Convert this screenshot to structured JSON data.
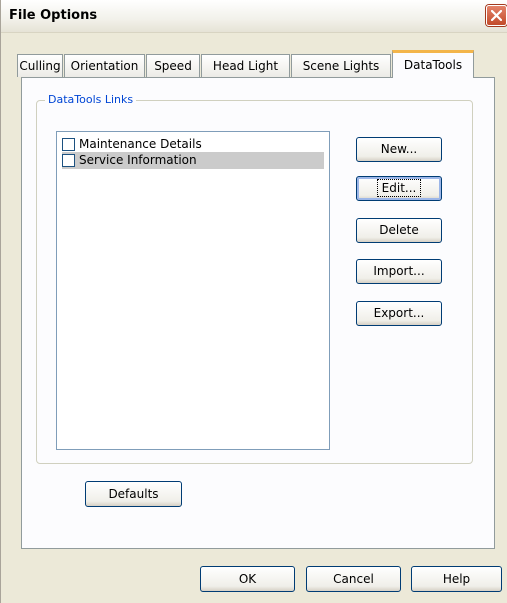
{
  "window": {
    "title": "File Options"
  },
  "tabs": [
    "Culling",
    "Orientation",
    "Speed",
    "Head Light",
    "Scene Lights",
    "DataTools"
  ],
  "group": {
    "label": "DataTools Links"
  },
  "list": {
    "items": [
      {
        "label": "Maintenance Details",
        "checked": false,
        "selected": false
      },
      {
        "label": "Service Information",
        "checked": false,
        "selected": true
      }
    ]
  },
  "side_buttons": {
    "new": "New...",
    "edit": "Edit...",
    "delete": "Delete",
    "import": "Import...",
    "export": "Export..."
  },
  "defaults_button": "Defaults",
  "footer": {
    "ok": "OK",
    "cancel": "Cancel",
    "help": "Help"
  },
  "colors": {
    "accent": "#f3b54a",
    "group_label": "#0046d5",
    "close": "#c24a2a",
    "selection": "#cbcbcb"
  }
}
